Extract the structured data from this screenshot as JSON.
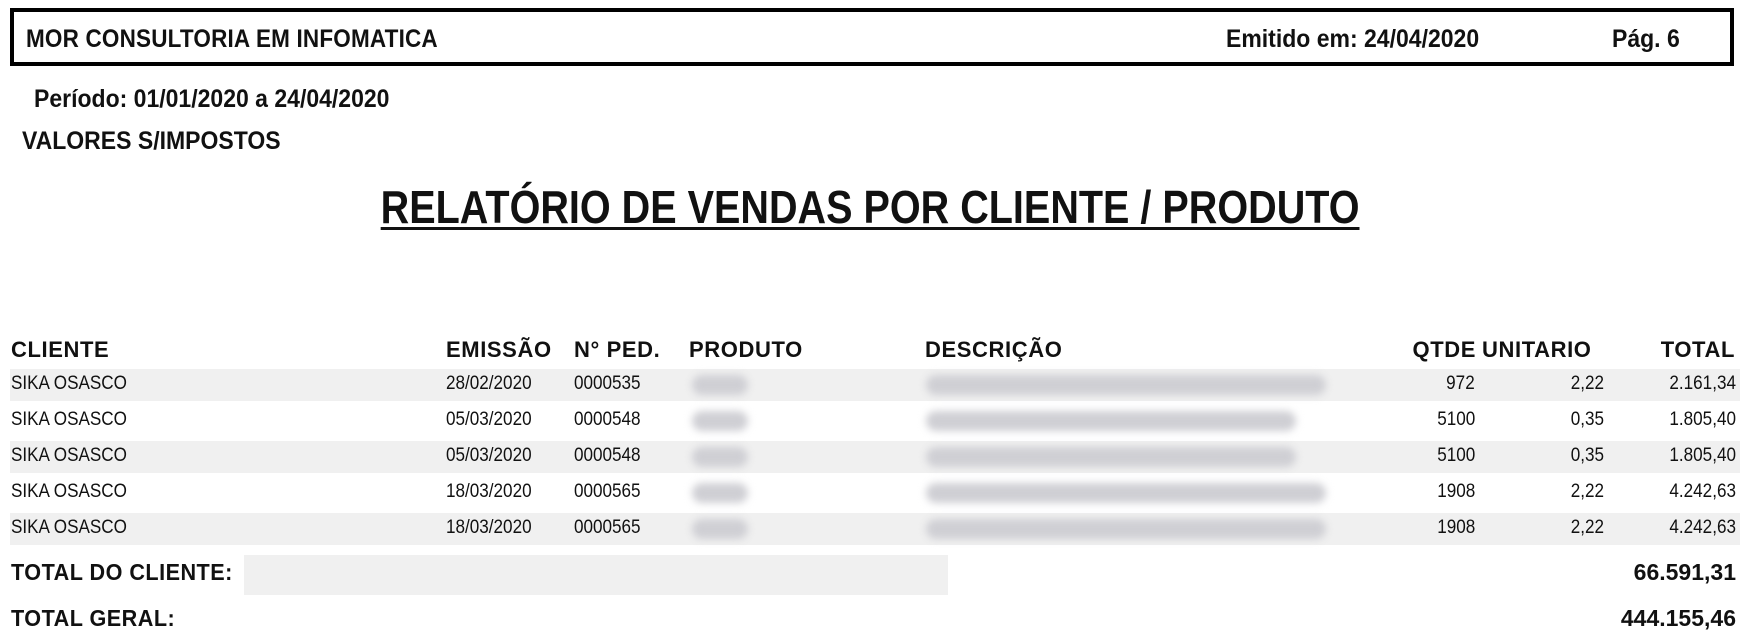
{
  "header": {
    "company": "MOR CONSULTORIA EM INFOMATICA",
    "issued": "Emitido em: 24/04/2020",
    "page": "Pág. 6"
  },
  "period": "Período: 01/01/2020 a 24/04/2020",
  "values_note": "VALORES S/IMPOSTOS",
  "title": "RELATÓRIO DE VENDAS POR CLIENTE / PRODUTO",
  "columns": {
    "cliente": "CLIENTE",
    "emissao": "EMISSÃO",
    "pedido": "N° PED.",
    "produto": "PRODUTO",
    "descricao": "DESCRIÇÃO",
    "qtde": "QTDE",
    "unitario": "UNITARIO",
    "total": "TOTAL"
  },
  "rows": [
    {
      "cliente": "SIKA OSASCO",
      "emissao": "28/02/2020",
      "pedido": "0000535",
      "qtde": "972",
      "unitario": "2,22",
      "total": "2.161,34"
    },
    {
      "cliente": "SIKA OSASCO",
      "emissao": "05/03/2020",
      "pedido": "0000548",
      "qtde": "5100",
      "unitario": "0,35",
      "total": "1.805,40"
    },
    {
      "cliente": "SIKA OSASCO",
      "emissao": "05/03/2020",
      "pedido": "0000548",
      "qtde": "5100",
      "unitario": "0,35",
      "total": "1.805,40"
    },
    {
      "cliente": "SIKA OSASCO",
      "emissao": "18/03/2020",
      "pedido": "0000565",
      "qtde": "1908",
      "unitario": "2,22",
      "total": "4.242,63"
    },
    {
      "cliente": "SIKA OSASCO",
      "emissao": "18/03/2020",
      "pedido": "0000565",
      "qtde": "1908",
      "unitario": "2,22",
      "total": "4.242,63"
    }
  ],
  "totals": {
    "client_label": "TOTAL DO CLIENTE:",
    "client_value": "66.591,31",
    "grand_label": "TOTAL GERAL:",
    "grand_value": "444.155,46"
  }
}
